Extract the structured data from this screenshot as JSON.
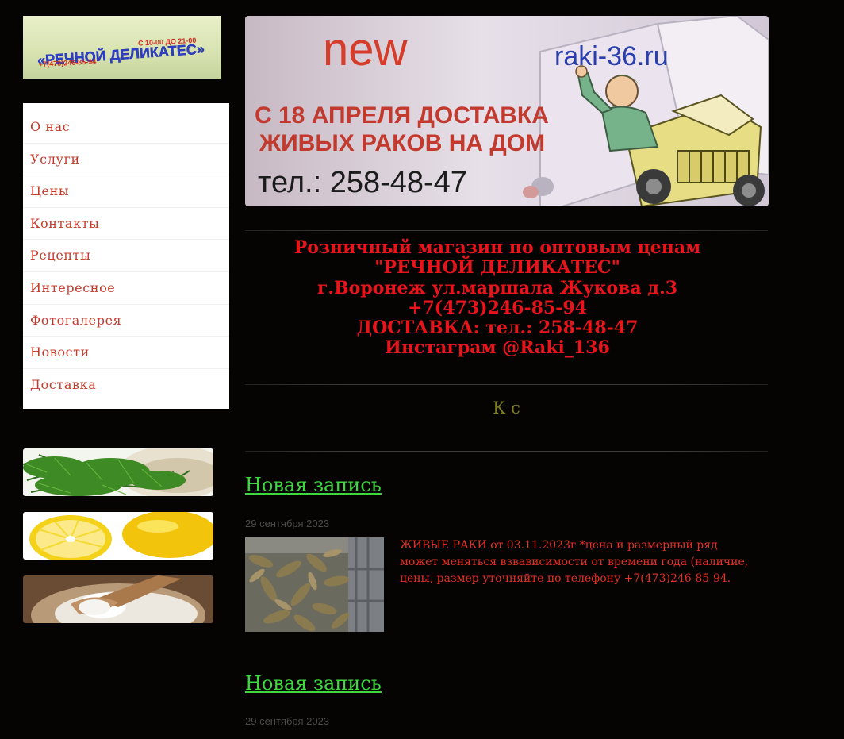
{
  "logo": {
    "name": "«РЕЧНОЙ ДЕЛИКАТЕС»",
    "hours": "С 10-00 ДО 21-00",
    "phone": "+7(473)246-85-94"
  },
  "nav": {
    "items": [
      {
        "label": "О нас"
      },
      {
        "label": "Услуги"
      },
      {
        "label": "Цены"
      },
      {
        "label": "Контакты"
      },
      {
        "label": "Рецепты"
      },
      {
        "label": "Интересное"
      },
      {
        "label": "Фотогалерея"
      },
      {
        "label": "Новости"
      },
      {
        "label": "Доставка"
      }
    ]
  },
  "sidebar_images": [
    {
      "name": "dill-image"
    },
    {
      "name": "lemon-image"
    },
    {
      "name": "salt-image"
    }
  ],
  "banner": {
    "new_label": "new",
    "site": "raki-36.ru",
    "line1": "С 18 АПРЕЛЯ ДОСТАВКА",
    "line2": "ЖИВЫХ РАКОВ НА ДОМ",
    "phone": "тел.: 258-48-47"
  },
  "info": {
    "line1": "Розничный магазин по оптовым ценам",
    "line2": "\"РЕЧНОЙ ДЕЛИКАТЕС\"",
    "line3": "г.Воронеж ул.маршала Жукова д.3",
    "line4": "+7(473)246-85-94",
    "line5": "ДОСТАВКА: тел.: 258-48-47",
    "line6": "Инстаграм @Raki_136"
  },
  "ks_text": "К с",
  "posts": [
    {
      "title": "Новая запись",
      "date": "29 сентября 2023",
      "text": "ЖИВЫЕ РАКИ от 03.11.2023г *цена и размерный ряд может меняться взвависимости от времени года (наличие, цены, размер уточняйте по телефону +7(473)246-85-94."
    },
    {
      "title": "Новая запись",
      "date": "29 сентября 2023"
    }
  ],
  "colors": {
    "background": "#060303",
    "nav_text": "#c43b2b",
    "info_text": "#e8141c",
    "post_title": "#3fd83f",
    "post_text": "#e63025",
    "ks_text": "#7e7d22"
  }
}
